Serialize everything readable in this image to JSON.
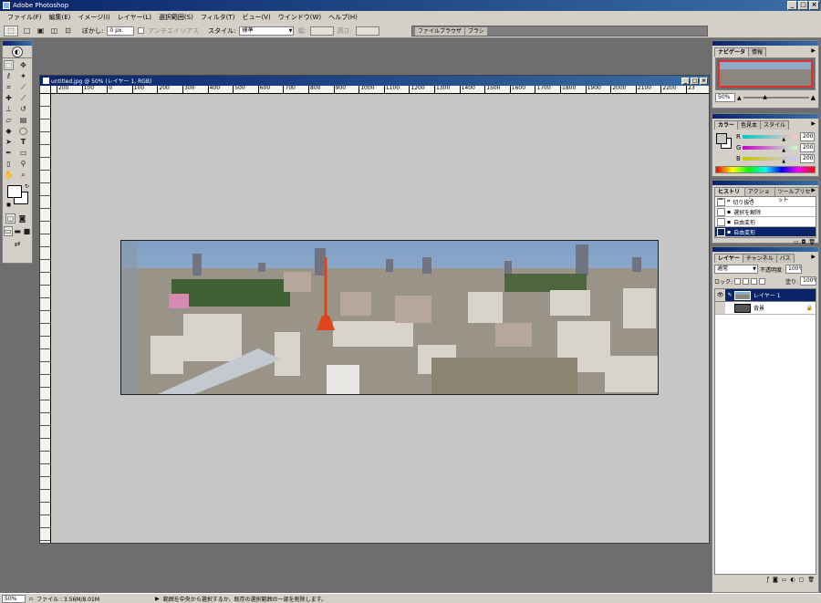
{
  "app": {
    "title": "Adobe Photoshop"
  },
  "menu": [
    "ファイル(F)",
    "編集(E)",
    "イメージ(I)",
    "レイヤー(L)",
    "選択範囲(S)",
    "フィルタ(T)",
    "ビュー(V)",
    "ウインドウ(W)",
    "ヘルプ(H)"
  ],
  "options": {
    "feather_label": "ぼかし:",
    "feather_value": "0 px",
    "antialias_label": "アンチエイリアス",
    "style_label": "スタイル:",
    "style_value": "標準",
    "width_label": "幅:",
    "height_label": "高さ:",
    "file_browser_tab": "ファイルブラウザ",
    "brush_tab": "ブラシ"
  },
  "document": {
    "title": "untitled.jpg @ 50% (レイヤー 1, RGB)",
    "ruler_marks": [
      "200",
      "100",
      "0",
      "100",
      "200",
      "300",
      "400",
      "500",
      "600",
      "700",
      "800",
      "900",
      "1000",
      "1100",
      "1200",
      "1300",
      "1400",
      "1500",
      "1600",
      "1700",
      "1800",
      "1900",
      "2000",
      "2100",
      "2200",
      "23"
    ]
  },
  "navigator": {
    "tabs": [
      "ナビゲータ",
      "情報"
    ],
    "zoom": "50%"
  },
  "color": {
    "tabs": [
      "カラー",
      "色見本",
      "スタイル"
    ],
    "channels": [
      {
        "label": "R",
        "value": "200"
      },
      {
        "label": "G",
        "value": "200"
      },
      {
        "label": "B",
        "value": "200"
      }
    ]
  },
  "history": {
    "tabs": [
      "ヒストリー",
      "アクション",
      "ツールプリセット"
    ],
    "items": [
      "切り抜き",
      "選択を解除",
      "自由変形",
      "自由変形"
    ]
  },
  "layers": {
    "tabs": [
      "レイヤー",
      "チャンネル",
      "パス"
    ],
    "blend_mode": "通常",
    "opacity_label": "不透明度:",
    "opacity_value": "100%",
    "lock_label": "ロック:",
    "fill_label": "塗り:",
    "fill_value": "100%",
    "items": [
      {
        "name": "レイヤー 1"
      },
      {
        "name": "背景"
      }
    ]
  },
  "status": {
    "zoom": "50%",
    "file_info": "ファイル : 3.56M/8.01M",
    "hint": "範囲を中央から選択するか、既存の選択範囲の一部を削除します。"
  },
  "colors": {
    "titlebar": "#0a246a",
    "selection": "#0a246a",
    "workspace": "#6e6e6e",
    "canvas_bg": "#c6c6c6",
    "navigator_frame": "#e03030"
  },
  "icons": {
    "tools": [
      "marquee-icon",
      "move-icon",
      "lasso-icon",
      "magic-wand-icon",
      "crop-icon",
      "slice-icon",
      "healing-brush-icon",
      "brush-icon",
      "clone-stamp-icon",
      "history-brush-icon",
      "eraser-icon",
      "gradient-icon",
      "blur-icon",
      "dodge-icon",
      "path-select-icon",
      "type-icon",
      "pen-icon",
      "shape-icon",
      "notes-icon",
      "eyedropper-icon",
      "hand-icon",
      "zoom-icon"
    ]
  }
}
